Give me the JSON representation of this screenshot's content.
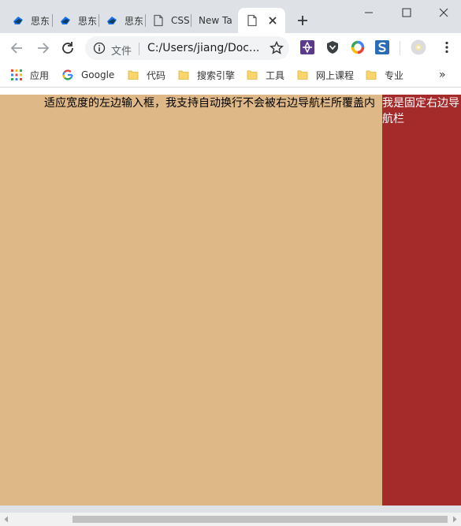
{
  "browser": {
    "tabs": [
      {
        "title": "思东",
        "icon": "xmind-icon"
      },
      {
        "title": "思东",
        "icon": "xmind-icon"
      },
      {
        "title": "思东",
        "icon": "xmind-icon"
      },
      {
        "title": "CSS",
        "icon": "page-icon"
      },
      {
        "title": "New Ta",
        "icon": "none"
      },
      {
        "title": "",
        "icon": "page-icon",
        "active": true
      }
    ],
    "address": {
      "label": "文件",
      "url": "C:/Users/jiang/Doc..."
    },
    "bookmarks": [
      {
        "label": "应用",
        "icon": "apps-grid-icon"
      },
      {
        "label": "Google",
        "icon": "google-icon"
      },
      {
        "label": "代码",
        "icon": "folder-icon"
      },
      {
        "label": "搜索引擎",
        "icon": "folder-icon"
      },
      {
        "label": "工具",
        "icon": "folder-icon"
      },
      {
        "label": "网上课程",
        "icon": "folder-icon"
      },
      {
        "label": "专业",
        "icon": "folder-icon"
      }
    ],
    "overflow_label": "»"
  },
  "page": {
    "left_text": "适应宽度的左边输入框，我支持自动换行不会被右边导航栏所覆盖内",
    "right_text": "我是固定右边导航栏"
  },
  "colors": {
    "left_bg": "#deb887",
    "right_bg": "#a52a2a"
  }
}
